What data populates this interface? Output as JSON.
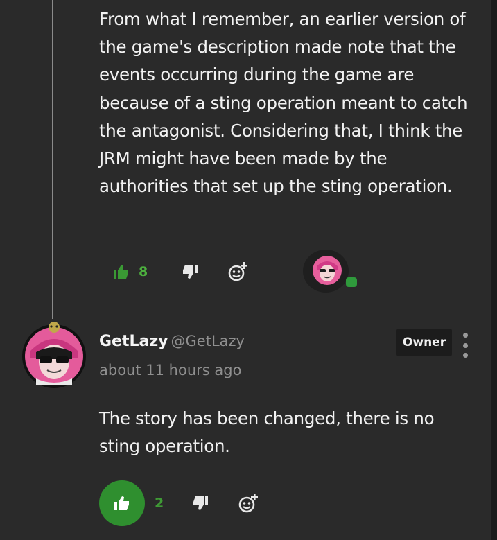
{
  "first_comment": {
    "text": "From what I remember, an earlier version of the game's description made note that the events occurring during the game are because of a sting operation meant to catch the antagonist. Considering that, I think the JRM might have been made by the authorities that set up the sting operation.",
    "likes": "8"
  },
  "reply": {
    "username": "GetLazy",
    "handle": "@GetLazy",
    "timestamp": "about 11 hours ago",
    "badge": "Owner",
    "text": "The story has been changed, there is no sting operation.",
    "likes": "2"
  },
  "colors": {
    "background": "#2a2a2a",
    "accent_green": "#2f8f2f",
    "text": "#f2f2f2",
    "muted": "#8f8f8f"
  },
  "icons": [
    "thumbs-up-icon",
    "thumbs-down-icon",
    "add-reaction-icon",
    "more-vertical-icon",
    "chat-bubble-icon"
  ]
}
